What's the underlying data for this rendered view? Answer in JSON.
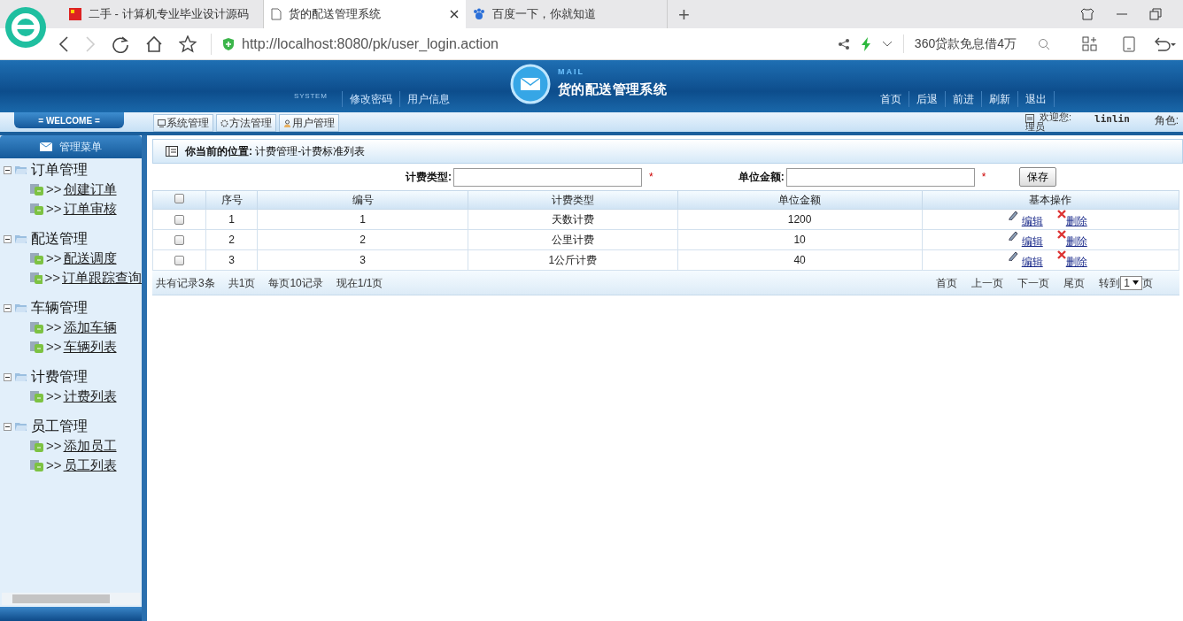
{
  "browser": {
    "tabs": [
      {
        "title": "二手 - 计算机专业毕业设计源码",
        "selected": false,
        "kind": "flag"
      },
      {
        "title": "货的配送管理系统",
        "selected": true,
        "kind": "page"
      },
      {
        "title": "百度一下，你就知道",
        "selected": false,
        "kind": "paw"
      }
    ],
    "new_tab": "+",
    "url": "http://localhost:8080/pk/user_login.action",
    "ad_text": "360贷款免息借4万"
  },
  "header": {
    "system_label": "SYSTEM",
    "left_links": [
      "修改密码",
      "用户信息"
    ],
    "logo_label": "MAIL",
    "app_title": "货的配送管理系统",
    "right_links": [
      "首页",
      "后退",
      "前进",
      "刷新",
      "退出"
    ]
  },
  "toolbar": {
    "welcome": "= WELCOME =",
    "tabs": [
      {
        "label": "系统管理",
        "kind": "monitor"
      },
      {
        "label": "方法管理",
        "kind": "gear"
      },
      {
        "label": "用户管理",
        "kind": "user"
      }
    ],
    "greeting": "欢迎您:",
    "username": "linlin",
    "role_label": "角色:",
    "role_overflow": "理员"
  },
  "sidebar": {
    "title": "管理菜单",
    "groups": [
      {
        "label": "订单管理",
        "expanded": true,
        "children": [
          {
            "prefix": ">>",
            "label": "创建订单"
          },
          {
            "prefix": ">>",
            "label": "订单审核"
          }
        ]
      },
      {
        "label": "配送管理",
        "expanded": true,
        "children": [
          {
            "prefix": ">>",
            "label": "配送调度"
          },
          {
            "prefix": ">>",
            "label": "订单跟踪查询"
          }
        ]
      },
      {
        "label": "车辆管理",
        "expanded": true,
        "children": [
          {
            "prefix": ">>",
            "label": "添加车辆"
          },
          {
            "prefix": ">>",
            "label": "车辆列表"
          }
        ]
      },
      {
        "label": "计费管理",
        "expanded": true,
        "children": [
          {
            "prefix": ">>",
            "label": "计费列表"
          }
        ]
      },
      {
        "label": "员工管理",
        "expanded": true,
        "children": [
          {
            "prefix": ">>",
            "label": "添加员工"
          },
          {
            "prefix": ">>",
            "label": "员工列表"
          }
        ]
      }
    ]
  },
  "main": {
    "breadcrumb_label": "你当前的位置:",
    "breadcrumb": "计费管理-计费标准列表",
    "form": {
      "fields": [
        {
          "label": "计费类型:",
          "required": "*"
        },
        {
          "label": "单位金额:",
          "required": "*"
        }
      ],
      "save": "保存"
    },
    "table": {
      "select_all": {
        "checked": false
      },
      "columns": [
        "序号",
        "编号",
        "计费类型",
        "单位金额",
        "基本操作"
      ],
      "rows": [
        {
          "checked": false,
          "cells": [
            "1",
            "1",
            "天数计费",
            "1200"
          ],
          "actions": [
            "编辑",
            "删除"
          ]
        },
        {
          "checked": false,
          "cells": [
            "2",
            "2",
            "公里计费",
            "10"
          ],
          "actions": [
            "编辑",
            "删除"
          ]
        },
        {
          "checked": false,
          "cells": [
            "3",
            "3",
            "1公斤计费",
            "40"
          ],
          "actions": [
            "编辑",
            "删除"
          ]
        }
      ]
    },
    "pager": {
      "info": [
        "共有记录3条",
        "共1页",
        "每页10记录",
        "现在1/1页"
      ],
      "links": [
        "首页",
        "上一页",
        "下一页",
        "尾页"
      ],
      "goto": "转到",
      "page": "1",
      "page_suffix": "页"
    }
  }
}
